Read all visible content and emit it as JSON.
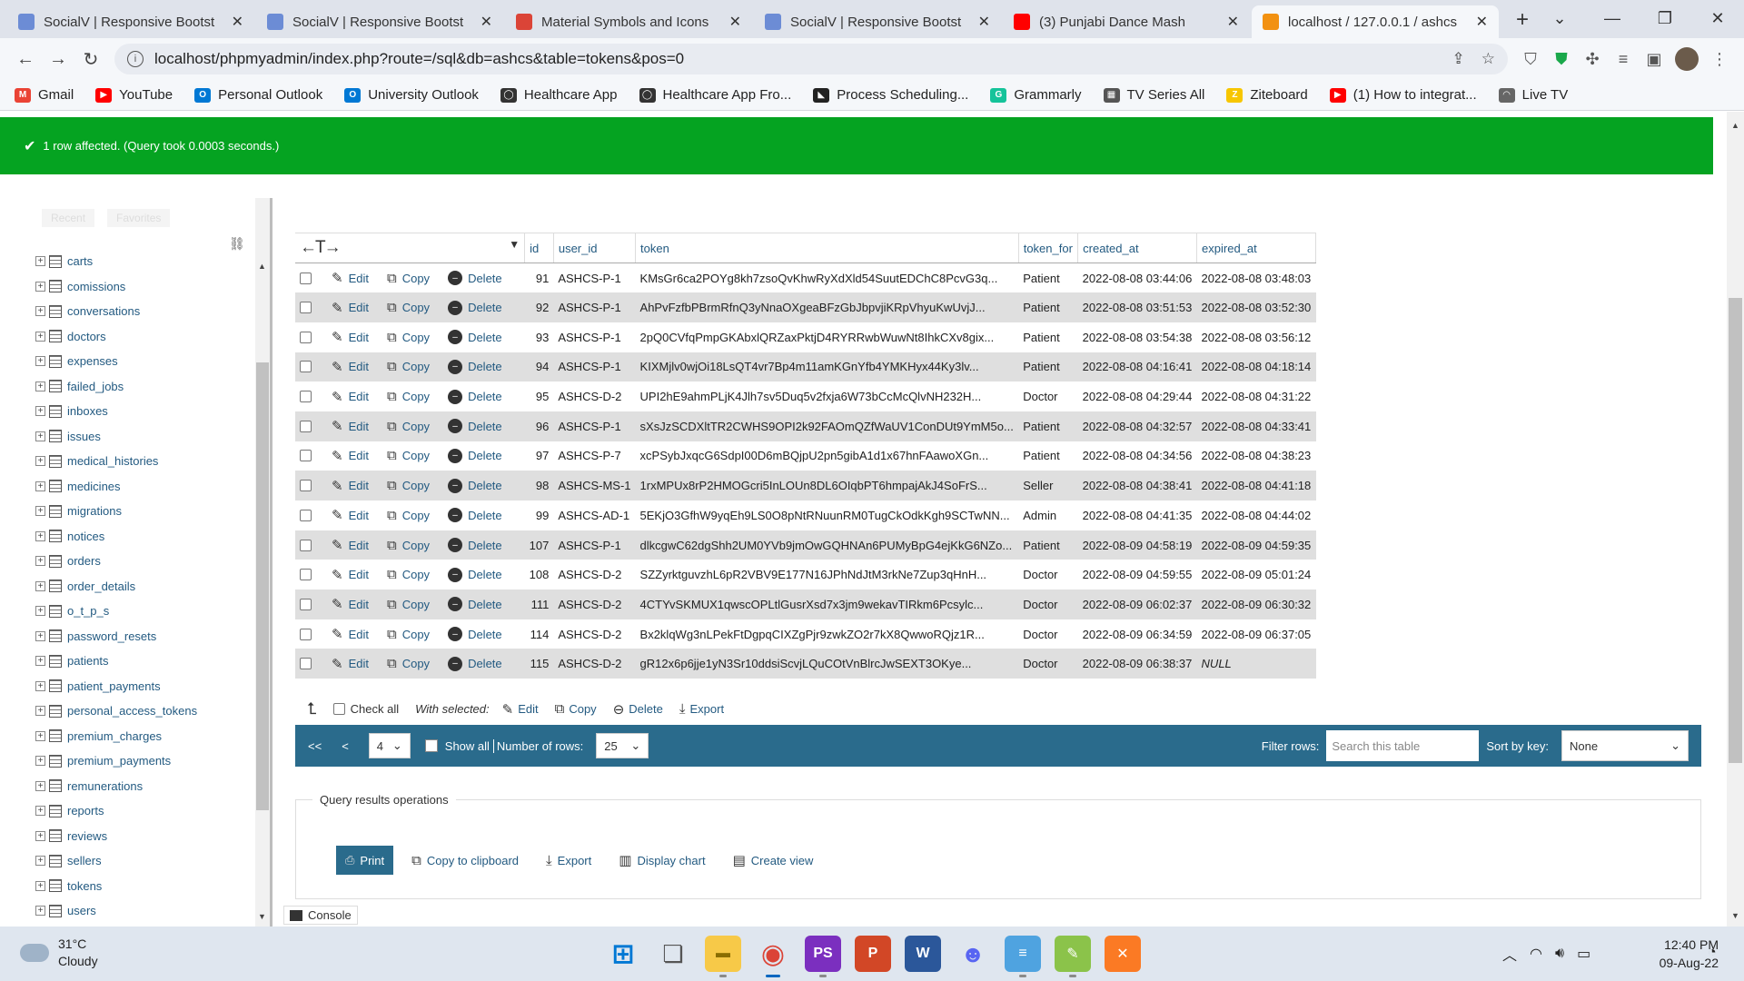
{
  "browser": {
    "tabs": [
      {
        "title": "SocialV | Responsive Bootst",
        "favicon_color": "#6c8cd5",
        "active": false
      },
      {
        "title": "SocialV | Responsive Bootst",
        "favicon_color": "#6c8cd5",
        "active": false
      },
      {
        "title": "Material Symbols and Icons",
        "favicon_color": "#db4437",
        "active": false
      },
      {
        "title": "SocialV | Responsive Bootst",
        "favicon_color": "#6c8cd5",
        "active": false
      },
      {
        "title": "(3) Punjabi Dance Mash",
        "favicon_color": "#ff0000",
        "active": false
      },
      {
        "title": "localhost / 127.0.0.1 / ashcs",
        "favicon_color": "#f29111",
        "active": true
      }
    ],
    "url": "localhost/phpmyadmin/index.php?route=/sql&db=ashcs&table=tokens&pos=0",
    "bookmarks": [
      {
        "label": "Gmail",
        "color": "#ea4335",
        "glyph": "M"
      },
      {
        "label": "YouTube",
        "color": "#ff0000",
        "glyph": "▶"
      },
      {
        "label": "Personal Outlook",
        "color": "#0078d4",
        "glyph": "O"
      },
      {
        "label": "University Outlook",
        "color": "#0078d4",
        "glyph": "O"
      },
      {
        "label": "Healthcare App",
        "color": "#333333",
        "glyph": "◯"
      },
      {
        "label": "Healthcare App Fro...",
        "color": "#333333",
        "glyph": "◯"
      },
      {
        "label": "Process Scheduling...",
        "color": "#222222",
        "glyph": "◣"
      },
      {
        "label": "Grammarly",
        "color": "#15c39a",
        "glyph": "G"
      },
      {
        "label": "TV Series All",
        "color": "#555555",
        "glyph": "▦"
      },
      {
        "label": "Ziteboard",
        "color": "#f7c600",
        "glyph": "Z"
      },
      {
        "label": "(1) How to integrat...",
        "color": "#ff0000",
        "glyph": "▶"
      },
      {
        "label": "Live TV",
        "color": "#666666",
        "glyph": "◠"
      }
    ]
  },
  "message": {
    "text": "1 row affected. (Query took 0.0003 seconds.)",
    "color": "#05a321"
  },
  "navigation": {
    "tab_recent": "Recent",
    "tab_favorites": "Favorites",
    "tables": [
      "carts",
      "comissions",
      "conversations",
      "doctors",
      "expenses",
      "failed_jobs",
      "inboxes",
      "issues",
      "medical_histories",
      "medicines",
      "migrations",
      "notices",
      "orders",
      "order_details",
      "o_t_p_s",
      "password_resets",
      "patients",
      "patient_payments",
      "personal_access_tokens",
      "premium_charges",
      "premium_payments",
      "remunerations",
      "reports",
      "reviews",
      "sellers",
      "tokens",
      "users"
    ]
  },
  "table": {
    "columns": [
      "id",
      "user_id",
      "token",
      "token_for",
      "created_at",
      "expired_at"
    ],
    "action_labels": {
      "edit": "Edit",
      "copy": "Copy",
      "delete": "Delete"
    },
    "rows": [
      [
        "91",
        "ASHCS-P-1",
        "KMsGr6ca2POYg8kh7zsoQvKhwRyXdXld54SuutEDChC8PcvG3q...",
        "Patient",
        "2022-08-08 03:44:06",
        "2022-08-08 03:48:03"
      ],
      [
        "92",
        "ASHCS-P-1",
        "AhPvFzfbPBrmRfnQ3yNnaOXgeaBFzGbJbpvjiKRpVhyuKwUvjJ...",
        "Patient",
        "2022-08-08 03:51:53",
        "2022-08-08 03:52:30"
      ],
      [
        "93",
        "ASHCS-P-1",
        "2pQ0CVfqPmpGKAbxlQRZaxPktjD4RYRRwbWuwNt8IhkCXv8gix...",
        "Patient",
        "2022-08-08 03:54:38",
        "2022-08-08 03:56:12"
      ],
      [
        "94",
        "ASHCS-P-1",
        "KIXMjlv0wjOi18LsQT4vr7Bp4m11amKGnYfb4YMKHyx44Ky3lv...",
        "Patient",
        "2022-08-08 04:16:41",
        "2022-08-08 04:18:14"
      ],
      [
        "95",
        "ASHCS-D-2",
        "UPI2hE9ahmPLjK4Jlh7sv5Duq5v2fxja6W73bCcMcQlvNH232H...",
        "Doctor",
        "2022-08-08 04:29:44",
        "2022-08-08 04:31:22"
      ],
      [
        "96",
        "ASHCS-P-1",
        "sXsJzSCDXltTR2CWHS9OPI2k92FAOmQZfWaUV1ConDUt9YmM5o...",
        "Patient",
        "2022-08-08 04:32:57",
        "2022-08-08 04:33:41"
      ],
      [
        "97",
        "ASHCS-P-7",
        "xcPSybJxqcG6SdpI00D6mBQjpU2pn5gibA1d1x67hnFAawoXGn...",
        "Patient",
        "2022-08-08 04:34:56",
        "2022-08-08 04:38:23"
      ],
      [
        "98",
        "ASHCS-MS-1",
        "1rxMPUx8rP2HMOGcri5InLOUn8DL6OIqbPT6hmpajAkJ4SoFrS...",
        "Seller",
        "2022-08-08 04:38:41",
        "2022-08-08 04:41:18"
      ],
      [
        "99",
        "ASHCS-AD-1",
        "5EKjO3GfhW9yqEh9LS0O8pNtRNuunRM0TugCkOdkKgh9SCTwNN...",
        "Admin",
        "2022-08-08 04:41:35",
        "2022-08-08 04:44:02"
      ],
      [
        "107",
        "ASHCS-P-1",
        "dlkcgwC62dgShh2UM0YVb9jmOwGQHNAn6PUMyBpG4ejKkG6NZo...",
        "Patient",
        "2022-08-09 04:58:19",
        "2022-08-09 04:59:35"
      ],
      [
        "108",
        "ASHCS-D-2",
        "SZZyrktguvzhL6pR2VBV9E177N16JPhNdJtM3rkNe7Zup3qHnH...",
        "Doctor",
        "2022-08-09 04:59:55",
        "2022-08-09 05:01:24"
      ],
      [
        "111",
        "ASHCS-D-2",
        "4CTYvSKMUX1qwscOPLtlGusrXsd7x3jm9wekavTIRkm6Pcsylc...",
        "Doctor",
        "2022-08-09 06:02:37",
        "2022-08-09 06:30:32"
      ],
      [
        "114",
        "ASHCS-D-2",
        "Bx2klqWg3nLPekFtDgpqCIXZgPjr9zwkZO2r7kX8QwwoRQjz1R...",
        "Doctor",
        "2022-08-09 06:34:59",
        "2022-08-09 06:37:05"
      ],
      [
        "115",
        "ASHCS-D-2",
        "gR12x6p6jje1yN3Sr10ddsiScvjLQuCOtVnBlrcJwSEXT3OKye...",
        "Doctor",
        "2022-08-09 06:38:37",
        "NULL"
      ]
    ]
  },
  "bulk": {
    "check_all": "Check all",
    "with_selected": "With selected:",
    "edit": "Edit",
    "copy": "Copy",
    "delete": "Delete",
    "export": "Export"
  },
  "pager": {
    "first": "<<",
    "prev": "<",
    "page": "4",
    "show_all": "Show all",
    "number_of_rows_label": "Number of rows:",
    "number_of_rows": "25",
    "filter_label": "Filter rows:",
    "filter_placeholder": "Search this table",
    "sort_label": "Sort by key:",
    "sort_value": "None"
  },
  "operations": {
    "legend": "Query results operations",
    "print": "Print",
    "copy_clipboard": "Copy to clipboard",
    "export": "Export",
    "display_chart": "Display chart",
    "create_view": "Create view"
  },
  "console": {
    "label": "Console"
  },
  "taskbar": {
    "temperature": "31°C",
    "weather": "Cloudy",
    "time": "12:40 PM",
    "date": "09-Aug-22"
  }
}
